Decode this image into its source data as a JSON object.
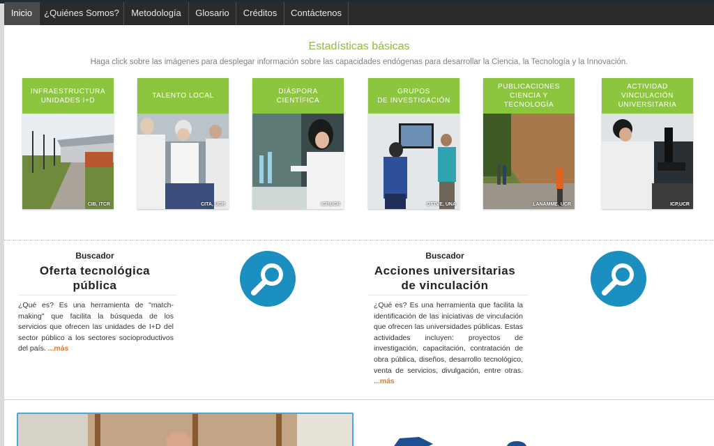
{
  "nav": {
    "items": [
      {
        "label": "Inicio",
        "active": true
      },
      {
        "label": "¿Quiénes Somos?",
        "active": false
      },
      {
        "label": "Metodología",
        "active": false
      },
      {
        "label": "Glosario",
        "active": false
      },
      {
        "label": "Créditos",
        "active": false
      },
      {
        "label": "Contáctenos",
        "active": false
      }
    ]
  },
  "stats": {
    "title": "Estadísticas básicas",
    "subtitle": "Haga click sobre las imágenes para desplegar información sobre las capacidades endógenas para desarrollar la Ciencia, la Tecnología y la Innovación."
  },
  "tiles": [
    {
      "title": "INFRAESTRUCTURA\nUNIDADES I+D",
      "credit": "CIB, ITCR"
    },
    {
      "title": "TALENTO LOCAL",
      "credit": "CITA, UCR"
    },
    {
      "title": "DIÁSPORA\nCIENTÍFICA",
      "credit": "ICP,UCR"
    },
    {
      "title": "GRUPOS\nDE INVESTIGACIÓN",
      "credit": "OTTVE, UNA"
    },
    {
      "title": "PUBLICACIONES\nCIENCIA Y TECNOLOGÍA",
      "credit": "LANAMME, UCR"
    },
    {
      "title": "ACTIVIDAD\nVINCULACIÓN\nUNIVERSITARIA",
      "credit": "ICP,UCR"
    }
  ],
  "buscador_left": {
    "label": "Buscador",
    "title": "Oferta tecnológica\npública",
    "description": "¿Qué es? Es una herramienta de \"match-making\" que facilita la búsqueda de los servicios que ofrecen las unidades de I+D del sector público a los sectores socioproductivos del país. ",
    "more": "...más"
  },
  "buscador_right": {
    "label": "Buscador",
    "title": "Acciones universitarias\nde vinculación",
    "description": "¿Qué es? Es una herramienta que facilita la identificación de las iniciativas de vinculación que ofrecen las universidades públicas. Estas actividades incluyen: proyectos de investigación, capacitación, contratación de obra pública, diseños, desarrollo tecnológico, venta de servicios, divulgación, entre otras. ",
    "more": "...más"
  },
  "colors": {
    "accent_green": "#8cc63f",
    "title_green": "#8cbe3f",
    "search_blue": "#1a8fc0",
    "more_orange": "#e07a2f",
    "nav_bg": "#2b2b2b"
  },
  "icons": [
    "magnifier-icon"
  ]
}
